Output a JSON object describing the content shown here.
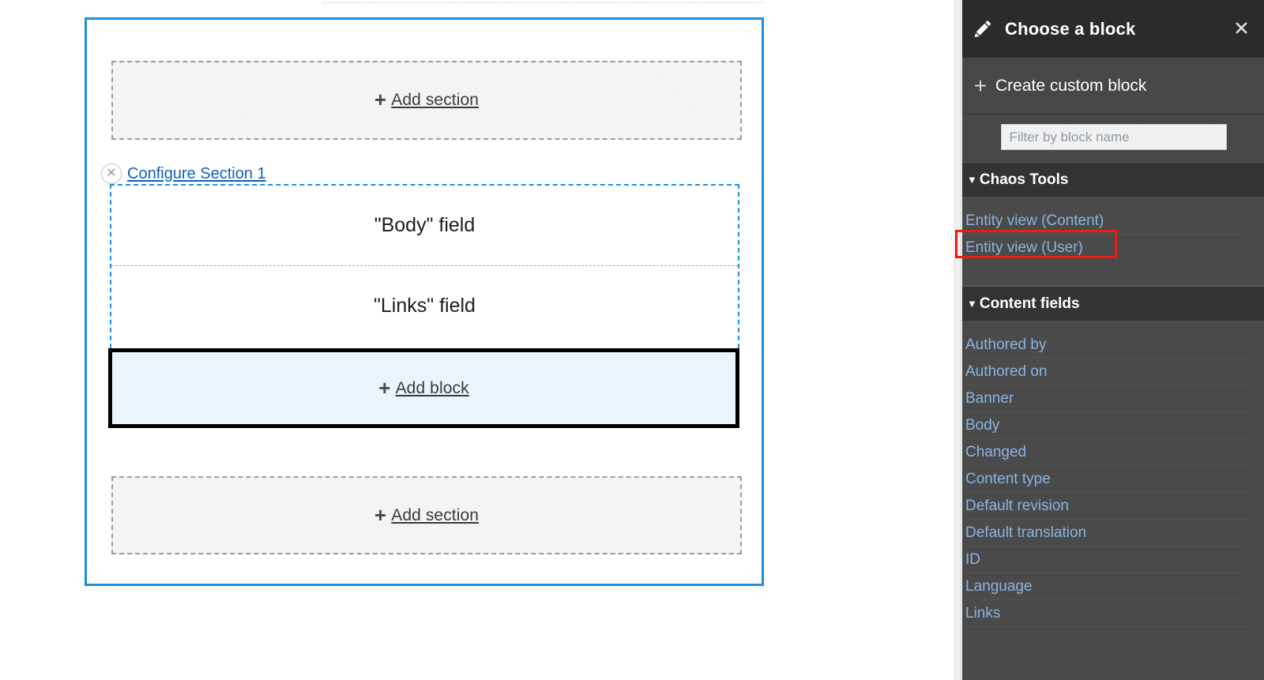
{
  "canvas": {
    "add_section_top": {
      "plus": "+",
      "label": "Add section"
    },
    "configure": {
      "remove_icon": "✕",
      "link_label": "Configure Section 1"
    },
    "blocks": [
      {
        "label": "\"Body\" field"
      },
      {
        "label": "\"Links\" field"
      }
    ],
    "add_block": {
      "plus": "+",
      "label": "Add block"
    },
    "add_section_bottom": {
      "plus": "+",
      "label": "Add section"
    }
  },
  "sidebar": {
    "header": {
      "icon": "pencil-icon",
      "title": "Choose a block",
      "close_label": "✕"
    },
    "create_custom_block": {
      "plus": "+",
      "label": "Create custom block"
    },
    "filter": {
      "value": "",
      "placeholder": "Filter by block name"
    },
    "groups": [
      {
        "caret": "▼",
        "title": "Chaos Tools",
        "items": [
          {
            "label": "Entity view (Content)",
            "highlighted": true
          },
          {
            "label": "Entity view (User)",
            "highlighted": false
          }
        ]
      },
      {
        "caret": "▼",
        "title": "Content fields",
        "items": [
          {
            "label": "Authored by"
          },
          {
            "label": "Authored on"
          },
          {
            "label": "Banner"
          },
          {
            "label": "Body"
          },
          {
            "label": "Changed"
          },
          {
            "label": "Content type"
          },
          {
            "label": "Default revision"
          },
          {
            "label": "Default translation"
          },
          {
            "label": "ID"
          },
          {
            "label": "Language"
          },
          {
            "label": "Links"
          }
        ]
      }
    ]
  },
  "colors": {
    "accent_blue": "#1e8fe0",
    "link_blue": "#1060b5",
    "sidebar_bg": "#4a4a4a",
    "sidebar_header_bg": "#2b2b2b",
    "sidebar_group_bg": "#333333",
    "sidebar_link": "#8ab4e0",
    "highlight_red": "#f01a10",
    "add_block_bg": "#eaf4fd"
  }
}
